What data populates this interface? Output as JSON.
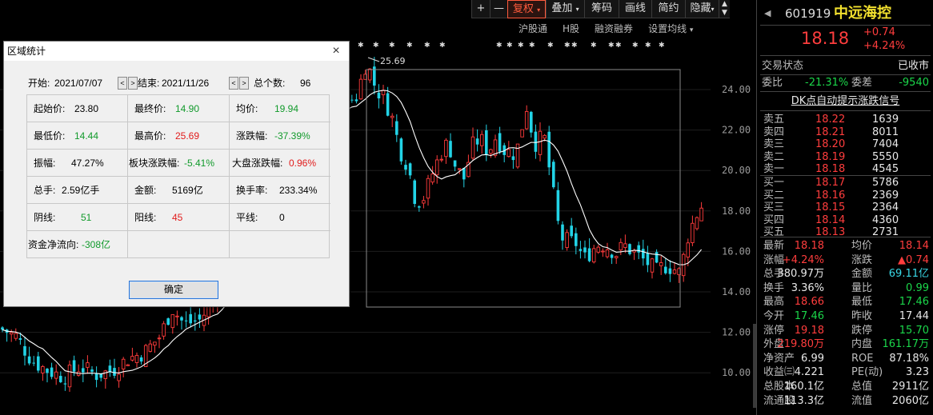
{
  "toolbar": {
    "add_label": "+",
    "minus_label": "—",
    "items": [
      {
        "label": "复权",
        "active": true,
        "has_dropdown": true
      },
      {
        "label": "叠加",
        "has_dropdown": true
      },
      {
        "label": "筹码"
      },
      {
        "label": "画线"
      },
      {
        "label": "简约"
      },
      {
        "label": "隐藏",
        "has_dropdown": true
      }
    ],
    "scroll_up": "▲",
    "scroll_down": "▼"
  },
  "subnav": [
    "沪股通",
    "H股",
    "融资融券",
    "设置均线"
  ],
  "chart": {
    "y_ticks": [
      "24.00",
      "22.00",
      "20.00",
      "18.00",
      "16.00",
      "14.00",
      "12.00",
      "10.00"
    ],
    "peak_label": "25.69",
    "up_color": "#ff3b3b",
    "down_color": "#22d3e6",
    "ma_color": "#ffffff"
  },
  "dialog": {
    "title": "区域统计",
    "start_label": "开始:",
    "start_value": "2021/07/07",
    "end_label": "结束:",
    "end_value": "2021/11/26",
    "count_label": "总个数:",
    "count_value": "96",
    "prev_btn": "<",
    "next_btn": ">",
    "stats": {
      "open_label": "起始价:",
      "open_value": "23.80",
      "close_label": "最终价:",
      "close_value": "14.90",
      "avg_label": "均价:",
      "avg_value": "19.94",
      "low_label": "最低价:",
      "low_value": "14.44",
      "high_label": "最高价:",
      "high_value": "25.69",
      "change_label": "涨跌幅:",
      "change_value": "-37.39%",
      "amp_label": "振幅:",
      "amp_value": "47.27%",
      "sector_label": "板块涨跌幅:",
      "sector_value": "-5.41%",
      "market_label": "大盘涨跌幅:",
      "market_value": "0.96%",
      "vol_label": "总手:",
      "vol_value": "2.59亿手",
      "amount_label": "金额:",
      "amount_value": "5169亿",
      "turnover_label": "换手率:",
      "turnover_value": "233.34%",
      "down_label": "阴线:",
      "down_value": "51",
      "up_label": "阳线:",
      "up_value": "45",
      "flat_label": "平线:",
      "flat_value": "0",
      "flow_label": "资金净流向:",
      "flow_value": "-308亿"
    },
    "ok_label": "确定",
    "close_icon": "×"
  },
  "panel": {
    "code": "601919",
    "name": "中远海控",
    "price": "18.18",
    "change": "+0.74",
    "change_pct": "+4.24%",
    "status_label": "交易状态",
    "status_value": "已收市",
    "webi_label": "委比",
    "webi_value": "-21.31%",
    "wecha_label": "委差",
    "wecha_value": "-9540",
    "signal_link": "DK点自动提示涨跌信号",
    "asks": [
      {
        "label": "卖五",
        "price": "18.22",
        "vol": "1639"
      },
      {
        "label": "卖四",
        "price": "18.21",
        "vol": "8011"
      },
      {
        "label": "卖三",
        "price": "18.20",
        "vol": "7404"
      },
      {
        "label": "卖二",
        "price": "18.19",
        "vol": "5550"
      },
      {
        "label": "卖一",
        "price": "18.18",
        "vol": "4545"
      }
    ],
    "bids": [
      {
        "label": "买一",
        "price": "18.17",
        "vol": "5786"
      },
      {
        "label": "买二",
        "price": "18.16",
        "vol": "2369"
      },
      {
        "label": "买三",
        "price": "18.15",
        "vol": "2364"
      },
      {
        "label": "买四",
        "price": "18.14",
        "vol": "4360"
      },
      {
        "label": "买五",
        "price": "18.13",
        "vol": "2731"
      }
    ],
    "stats": [
      {
        "l1": "最新",
        "v1": "18.18",
        "c1": "red",
        "l2": "均价",
        "v2": "18.14",
        "c2": "red"
      },
      {
        "l1": "涨幅",
        "v1": "+4.24%",
        "c1": "red",
        "l2": "涨跌",
        "v2": "▲0.74",
        "c2": "red"
      },
      {
        "l1": "总手",
        "v1": "380.97万",
        "c1": "white",
        "l2": "金额",
        "v2": "69.11亿",
        "c2": "cyan"
      },
      {
        "l1": "换手",
        "v1": "3.36%",
        "c1": "white",
        "l2": "量比",
        "v2": "0.99",
        "c2": "green"
      },
      {
        "l1": "最高",
        "v1": "18.66",
        "c1": "red",
        "l2": "最低",
        "v2": "17.46",
        "c2": "green"
      },
      {
        "l1": "今开",
        "v1": "17.46",
        "c1": "green",
        "l2": "昨收",
        "v2": "17.44",
        "c2": "white"
      },
      {
        "l1": "涨停",
        "v1": "19.18",
        "c1": "red",
        "l2": "跌停",
        "v2": "15.70",
        "c2": "green"
      },
      {
        "l1": "外盘",
        "v1": "219.80万",
        "c1": "red",
        "l2": "内盘",
        "v2": "161.17万",
        "c2": "green"
      },
      {
        "l1": "净资产",
        "v1": "6.99",
        "c1": "white",
        "l2": "ROE",
        "v2": "87.18%",
        "c2": "white"
      },
      {
        "l1": "收益㈢",
        "v1": "4.221",
        "c1": "white",
        "l2": "PE(动)",
        "v2": "3.23",
        "c2": "white"
      },
      {
        "l1": "总股本",
        "v1": "160.1亿",
        "c1": "white",
        "l2": "总值",
        "v2": "2911亿",
        "c2": "white"
      },
      {
        "l1": "流通股",
        "v1": "113.3亿",
        "c1": "white",
        "l2": "流值",
        "v2": "2060亿",
        "c2": "white"
      }
    ]
  }
}
